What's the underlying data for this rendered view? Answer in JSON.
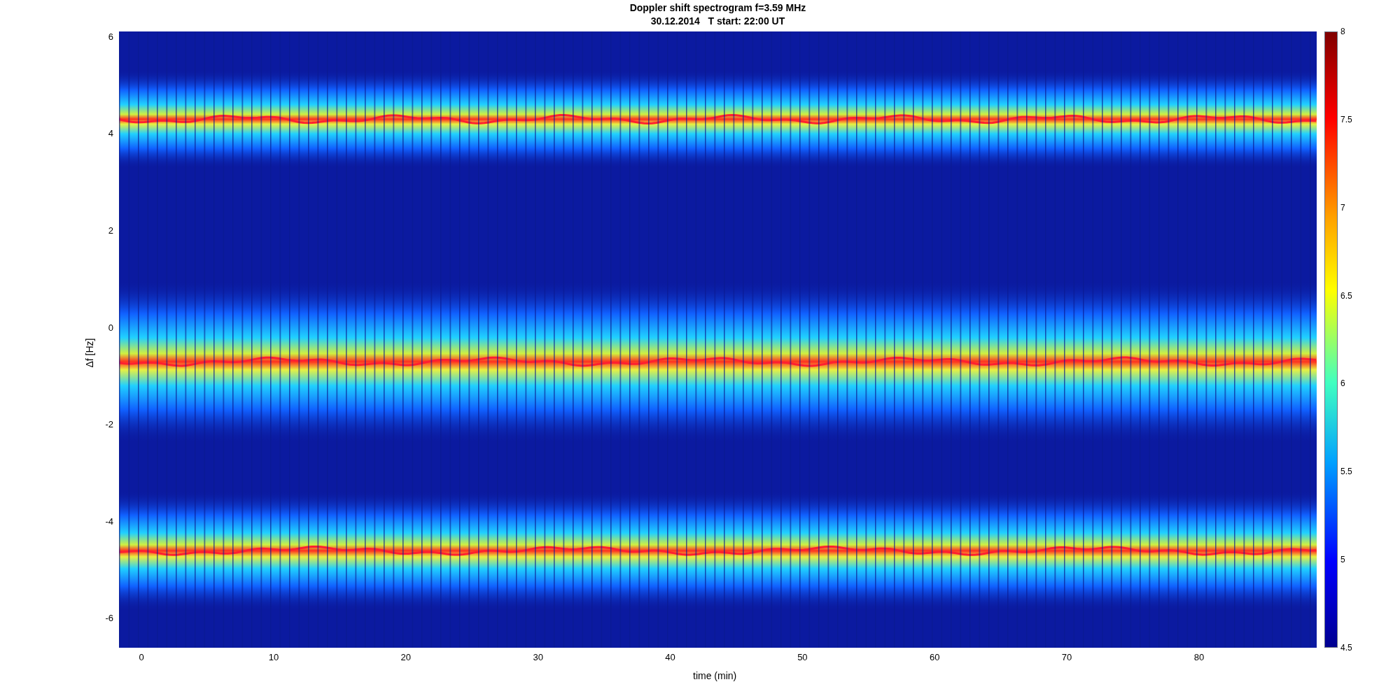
{
  "figure": {
    "title": "Doppler shift spectrogram f=3.59 MHz",
    "subtitle": "30.12.2014   T start: 22:00 UT",
    "xlabel": "time (min)",
    "ylabel": "Δf [Hz]",
    "xticks": [
      "0",
      "10",
      "20",
      "30",
      "40",
      "50",
      "60",
      "70",
      "80"
    ],
    "yticks": [
      "6",
      "4",
      "2",
      "0",
      "-2",
      "-4",
      "-6"
    ]
  },
  "colorbar": {
    "ticks": [
      "8",
      "7.5",
      "7",
      "6.5",
      "6",
      "5.5",
      "5",
      "4.5"
    ]
  }
}
